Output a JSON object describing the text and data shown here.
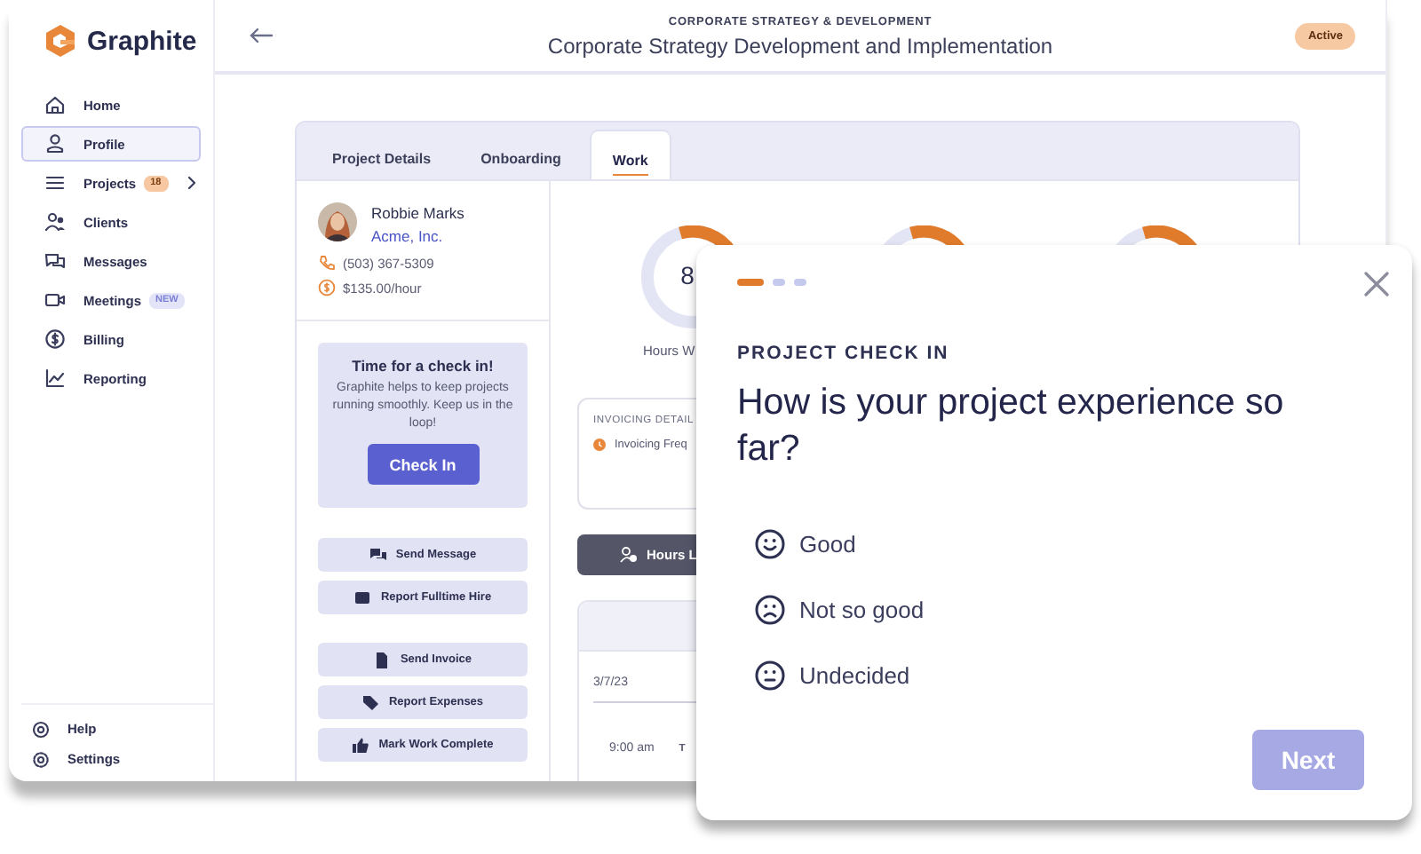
{
  "sidebar": {
    "logo": "Graphite",
    "items": [
      {
        "label": "Home",
        "selected": false,
        "expandable": false
      },
      {
        "label": "Profile",
        "selected": true,
        "expandable": false
      },
      {
        "label": "Projects",
        "selected": false,
        "expandable": true,
        "badge": {
          "text": "18",
          "kind": "count"
        }
      },
      {
        "label": "Clients",
        "selected": false,
        "expandable": false
      },
      {
        "label": "Messages",
        "selected": false,
        "expandable": false
      },
      {
        "label": "Meetings",
        "selected": false,
        "expandable": false,
        "badge": {
          "text": "NEW",
          "kind": "new"
        }
      },
      {
        "label": "Billing",
        "selected": false,
        "expandable": false
      },
      {
        "label": "Reporting",
        "selected": false,
        "expandable": false
      }
    ],
    "footer_items": [
      {
        "label": "Help"
      },
      {
        "label": "Settings"
      }
    ]
  },
  "header": {
    "overline": "CORPORATE STRATEGY & DEVELOPMENT",
    "title": "Corporate Strategy Development and Implementation",
    "status": "Active"
  },
  "tabs": [
    {
      "label": "Project Details",
      "selected": false
    },
    {
      "label": "Onboarding",
      "selected": false
    },
    {
      "label": "Work",
      "selected": true
    }
  ],
  "contact": {
    "name": "Robbie Marks",
    "company": "Acme, Inc.",
    "phone": "(503) 367-5309",
    "rate": "$135.00/hour"
  },
  "checkin_card": {
    "title": "Time for a check in!",
    "text": "Graphite helps to keep projects running smoothly. Keep us in the loop!",
    "button": "Check In"
  },
  "action_groups": [
    [
      {
        "label": "Send Message"
      },
      {
        "label": "Report Fulltime Hire"
      }
    ],
    [
      {
        "label": "Send Invoice"
      },
      {
        "label": "Report Expenses"
      },
      {
        "label": "Mark Work Complete"
      }
    ]
  ],
  "work": {
    "rings": [
      {
        "kind": "labeled",
        "value": "8",
        "label": "Hours W"
      },
      {
        "kind": "bare"
      },
      {
        "kind": "bare"
      }
    ],
    "invoicing": {
      "heading": "INVOICING DETAIL",
      "item": "Invoicing Freq"
    },
    "hours_button": "Hours L",
    "log": {
      "date": "3/7/23",
      "time": "9:00 am",
      "column_2": "T"
    }
  },
  "modal": {
    "steps": [
      {
        "current": true
      },
      {
        "current": false
      },
      {
        "current": false
      }
    ],
    "eyebrow": "PROJECT CHECK IN",
    "question": "How is your project experience so far?",
    "options": [
      {
        "label": "Good",
        "kind": "happy",
        "selected": false
      },
      {
        "label": "Not so good",
        "kind": "sad",
        "selected": false
      },
      {
        "label": "Undecided",
        "kind": "neutral",
        "selected": false
      }
    ],
    "next": {
      "label": "Next",
      "disabled": true
    }
  }
}
